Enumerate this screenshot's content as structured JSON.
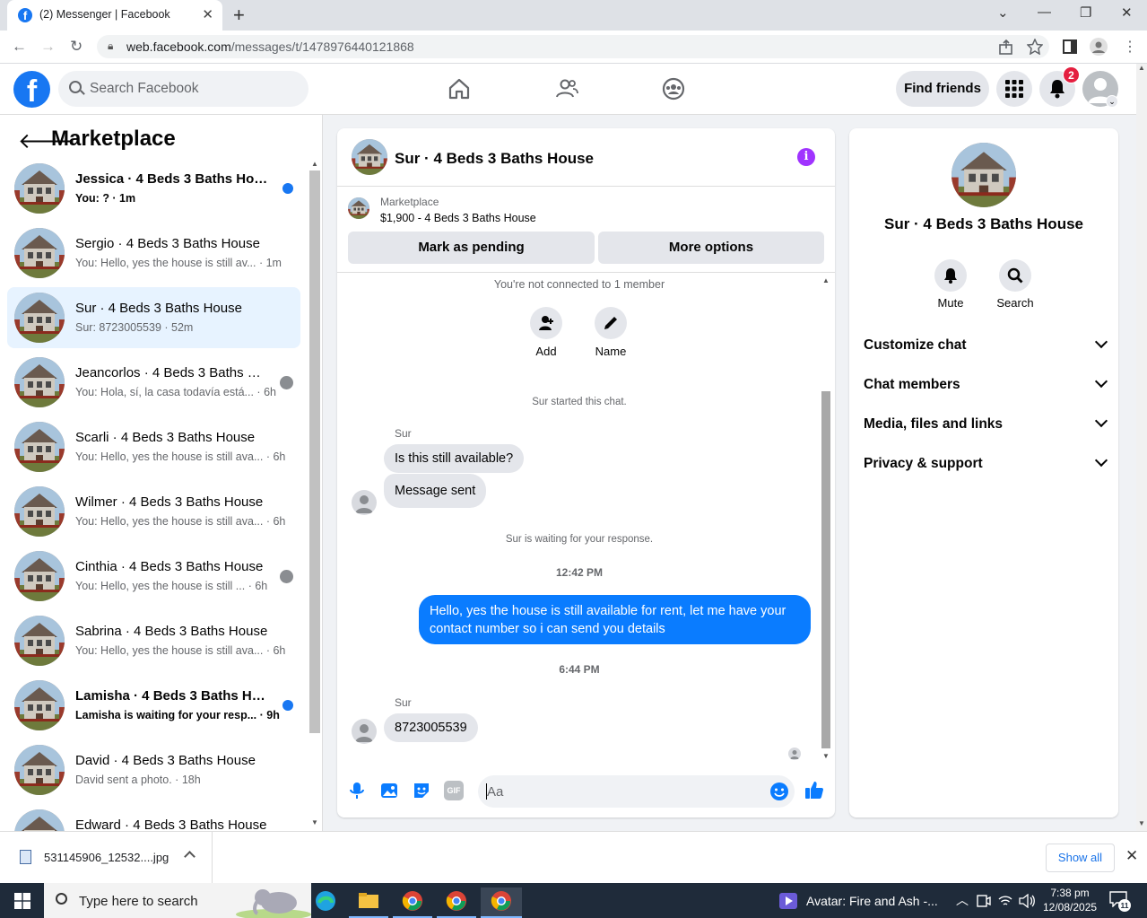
{
  "browser": {
    "tab_title": "(2) Messenger | Facebook",
    "url_host": "web.facebook.com",
    "url_path": "/messages/t/1478976440121868"
  },
  "fb": {
    "search_placeholder": "Search Facebook",
    "find_friends": "Find friends",
    "notification_count": "2",
    "brand_color": "#1877f2"
  },
  "sidebar": {
    "title": "Marketplace",
    "conversations": [
      {
        "name": "Jessica · 4 Beds 3 Baths House",
        "preview": "You: ? · 1m",
        "unread": true
      },
      {
        "name": "Sergio · 4 Beds 3 Baths House",
        "preview": "You: Hello, yes the house is still av... · 1m"
      },
      {
        "name": "Sur · 4 Beds 3 Baths House",
        "preview": "Sur: 8723005539 · 52m",
        "active": true
      },
      {
        "name": "Jeancorlos · 4 Beds 3 Baths H...",
        "preview": "You: Hola, sí, la casa todavía está... · 6h"
      },
      {
        "name": "Scarli · 4 Beds 3 Baths House",
        "preview": "You: Hello, yes the house is still ava... · 6h"
      },
      {
        "name": "Wilmer · 4 Beds 3 Baths House",
        "preview": "You: Hello, yes the house is still ava... · 6h"
      },
      {
        "name": "Cinthia · 4 Beds 3 Baths House",
        "preview": "You: Hello, yes the house is still ... · 6h"
      },
      {
        "name": "Sabrina · 4 Beds 3 Baths House",
        "preview": "You: Hello, yes the house is still ava... · 6h"
      },
      {
        "name": "Lamisha · 4 Beds 3 Baths House",
        "preview": "Lamisha is waiting for your resp... · 9h",
        "unread": true
      },
      {
        "name": "David · 4 Beds 3 Baths House",
        "preview": "David sent a photo. · 18h"
      },
      {
        "name": "Edward · 4 Beds 3 Baths House",
        "preview": ""
      }
    ]
  },
  "chat": {
    "title": "Sur · 4 Beds 3 Baths House",
    "marketplace_label": "Marketplace",
    "listing": "$1,900 - 4 Beds 3 Baths House",
    "mark_pending": "Mark as pending",
    "more_options": "More options",
    "not_connected": "You're not connected to 1 member",
    "add_label": "Add",
    "name_label": "Name",
    "started": "Sur started this chat.",
    "sender": "Sur",
    "msg1": "Is this still available?",
    "msg2": "Message sent",
    "waiting": "Sur is waiting for your response.",
    "time1": "12:42 PM",
    "outgoing": "Hello, yes the house is still available for rent, let me have your contact number so i can send you  details",
    "time2": "6:44 PM",
    "msg3": "8723005539",
    "input_placeholder": "Aa",
    "gif_label": "GIF"
  },
  "details": {
    "title": "Sur · 4 Beds 3 Baths House",
    "mute": "Mute",
    "search": "Search",
    "sections": [
      "Customize chat",
      "Chat members",
      "Media, files and links",
      "Privacy & support"
    ]
  },
  "downloads": {
    "file": "531145906_12532....jpg",
    "show_all": "Show all"
  },
  "taskbar": {
    "search_placeholder": "Type here to search",
    "media": "Avatar: Fire and Ash -...",
    "time": "7:38 pm",
    "date": "12/08/2025",
    "notif_count": "11"
  }
}
